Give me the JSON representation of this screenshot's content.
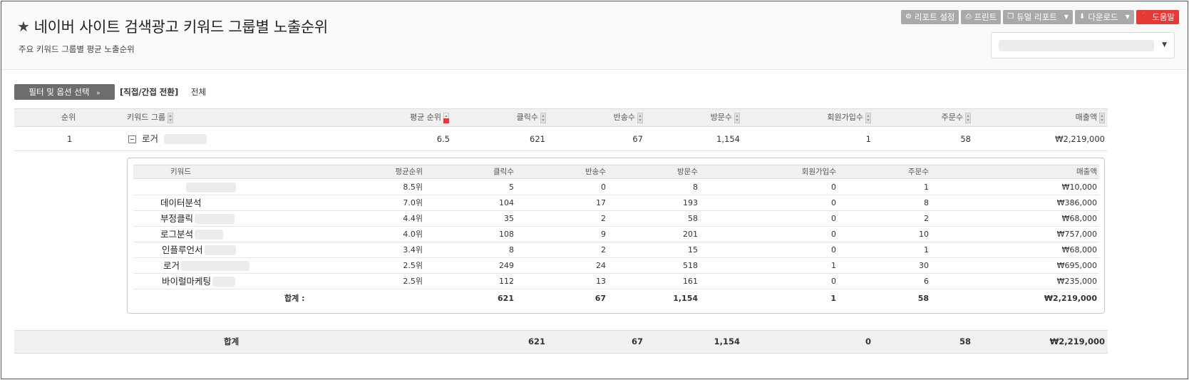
{
  "header": {
    "title": "네이버 사이트 검색광고 키워드 그룹별 노출순위",
    "subtitle": "주요 키워드 그룹별 평균 노출순위",
    "title_icon": "star-icon"
  },
  "toolbar": {
    "report_settings": "리포트 설정",
    "print": "프린트",
    "dual_report": "듀얼 리포트",
    "download": "다운로드",
    "help": "도움말",
    "help_color": "#e53935"
  },
  "filter": {
    "button_label": "필터 및 옵션 선택",
    "toggle_label": "[직접/간접 전환]",
    "value": "전체"
  },
  "main_table": {
    "columns": [
      "순위",
      "키워드 그룹",
      "평균 순위",
      "클릭수",
      "반송수",
      "방문수",
      "회원가입수",
      "주문수",
      "매출액"
    ],
    "row": {
      "rank": "1",
      "group": "로거",
      "avg_rank": "6.5",
      "clicks": "621",
      "bounces": "67",
      "visits": "1,154",
      "signups": "1",
      "orders": "58",
      "revenue": "₩2,219,000"
    }
  },
  "sub_table": {
    "columns": [
      "키워드",
      "평균순위",
      "클릭수",
      "반송수",
      "방문수",
      "회원가입수",
      "주문수",
      "매출액"
    ],
    "rows": [
      {
        "keyword": "",
        "avg_rank": "8.5위",
        "clicks": "5",
        "bounces": "0",
        "visits": "8",
        "signups": "0",
        "orders": "1",
        "revenue": "₩10,000"
      },
      {
        "keyword": "데이터분석",
        "avg_rank": "7.0위",
        "clicks": "104",
        "bounces": "17",
        "visits": "193",
        "signups": "0",
        "orders": "8",
        "revenue": "₩386,000"
      },
      {
        "keyword": "부정클릭",
        "avg_rank": "4.4위",
        "clicks": "35",
        "bounces": "2",
        "visits": "58",
        "signups": "0",
        "orders": "2",
        "revenue": "₩68,000"
      },
      {
        "keyword": "로그분석",
        "avg_rank": "4.0위",
        "clicks": "108",
        "bounces": "9",
        "visits": "201",
        "signups": "0",
        "orders": "10",
        "revenue": "₩757,000"
      },
      {
        "keyword": "인플루언서",
        "avg_rank": "3.4위",
        "clicks": "8",
        "bounces": "2",
        "visits": "15",
        "signups": "0",
        "orders": "1",
        "revenue": "₩68,000"
      },
      {
        "keyword": "로거",
        "avg_rank": "2.5위",
        "clicks": "249",
        "bounces": "24",
        "visits": "518",
        "signups": "1",
        "orders": "30",
        "revenue": "₩695,000"
      },
      {
        "keyword": "바이럴마케팅",
        "avg_rank": "2.5위",
        "clicks": "112",
        "bounces": "13",
        "visits": "161",
        "signups": "0",
        "orders": "6",
        "revenue": "₩235,000"
      }
    ],
    "total": {
      "label": "합계 :",
      "clicks": "621",
      "bounces": "67",
      "visits": "1,154",
      "signups": "1",
      "orders": "58",
      "revenue": "₩2,219,000"
    }
  },
  "footer": {
    "label": "합계",
    "clicks": "621",
    "bounces": "67",
    "visits": "1,154",
    "signups": "0",
    "orders": "58",
    "revenue": "₩2,219,000"
  }
}
